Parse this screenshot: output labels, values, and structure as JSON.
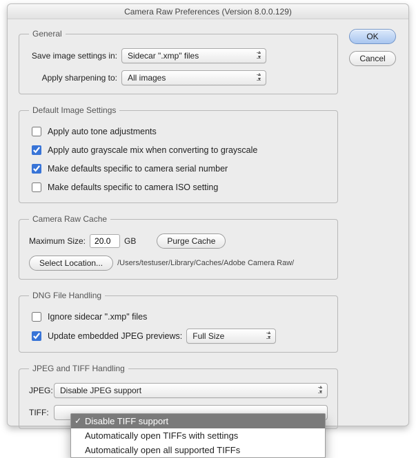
{
  "window_title": "Camera Raw Preferences  (Version 8.0.0.129)",
  "buttons": {
    "ok": "OK",
    "cancel": "Cancel"
  },
  "general": {
    "legend": "General",
    "save_label": "Save image settings in:",
    "save_value": "Sidecar \".xmp\" files",
    "sharpen_label": "Apply sharpening to:",
    "sharpen_value": "All images"
  },
  "defaults": {
    "legend": "Default Image Settings",
    "auto_tone": {
      "label": "Apply auto tone adjustments",
      "checked": false
    },
    "auto_gray": {
      "label": "Apply auto grayscale mix when converting to grayscale",
      "checked": true
    },
    "serial": {
      "label": "Make defaults specific to camera serial number",
      "checked": true
    },
    "iso": {
      "label": "Make defaults specific to camera ISO setting",
      "checked": false
    }
  },
  "cache": {
    "legend": "Camera Raw Cache",
    "max_label": "Maximum Size:",
    "max_value": "20.0",
    "gb": "GB",
    "purge": "Purge Cache",
    "select_loc": "Select Location...",
    "path": "/Users/testuser/Library/Caches/Adobe Camera Raw/"
  },
  "dng": {
    "legend": "DNG File Handling",
    "ignore": {
      "label": "Ignore sidecar \".xmp\" files",
      "checked": false
    },
    "update": {
      "label": "Update embedded JPEG previews:",
      "checked": true
    },
    "update_value": "Full Size"
  },
  "jpegtiff": {
    "legend": "JPEG and TIFF Handling",
    "jpeg_label": "JPEG:",
    "jpeg_value": "Disable JPEG support",
    "tiff_label": "TIFF:",
    "tiff_options": [
      "Disable TIFF support",
      "Automatically open TIFFs with settings",
      "Automatically open all supported TIFFs"
    ]
  }
}
